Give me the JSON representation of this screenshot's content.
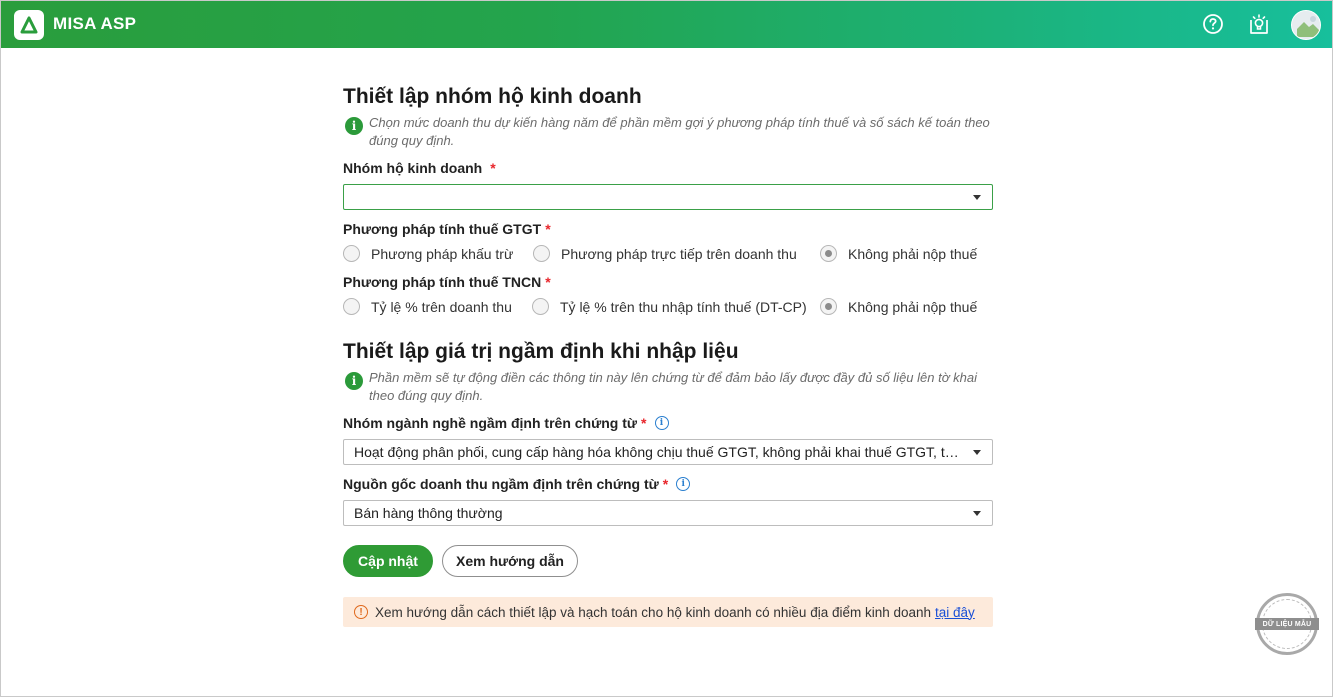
{
  "header": {
    "app_name": "MISA ASP",
    "icons": [
      "help-icon",
      "notification-lightbulb-icon",
      "avatar"
    ],
    "colors": {
      "gradient_start": "#2a9d3c",
      "gradient_end": "#17bf9c"
    }
  },
  "section1": {
    "title": "Thiết lập nhóm hộ kinh doanh",
    "hint": "Chọn mức doanh thu dự kiến hàng năm để phần mềm gợi ý phương pháp tính thuế và số sách kế toán theo đúng quy định.",
    "business_group": {
      "label": "Nhóm hộ kinh doanh",
      "required": "*",
      "value": ""
    },
    "vat_method": {
      "label": "Phương pháp tính thuế GTGT",
      "required": "*",
      "options": [
        "Phương pháp khấu trừ",
        "Phương pháp trực tiếp trên doanh thu",
        "Không phải nộp thuế"
      ],
      "selected": "Không phải nộp thuế"
    },
    "pit_method": {
      "label": "Phương pháp tính thuế TNCN",
      "required": "*",
      "options": [
        "Tỷ lệ % trên doanh thu",
        "Tỷ lệ % trên thu nhập tính thuế (DT-CP)",
        "Không phải nộp thuế"
      ],
      "selected": "Không phải nộp thuế"
    }
  },
  "section2": {
    "title": "Thiết lập giá trị ngầm định khi nhập liệu",
    "hint": "Phần mềm sẽ tự động điền các thông tin này lên chứng từ để đảm bảo lấy được đầy đủ số liệu lên tờ khai theo đúng quy định.",
    "industry_group": {
      "label": "Nhóm ngành nghề ngầm định trên chứng từ",
      "required": "*",
      "value": "Hoạt động phân phối, cung cấp hàng hóa không chịu thuế GTGT, không phải khai thuế GTGT, thuế TNCN"
    },
    "revenue_source": {
      "label": "Nguồn gốc doanh thu ngầm định trên chứng từ",
      "required": "*",
      "value": "Bán hàng thông thường"
    }
  },
  "actions": {
    "update_label": "Cập nhật",
    "guide_label": "Xem hướng dẫn"
  },
  "notice": {
    "text": "Xem hướng dẫn cách thiết lập và hạch toán cho hộ kinh doanh có nhiều địa điểm kinh doanh",
    "link": "tại đây"
  },
  "stamp": {
    "label": "DỮ LIỆU MẪU"
  }
}
